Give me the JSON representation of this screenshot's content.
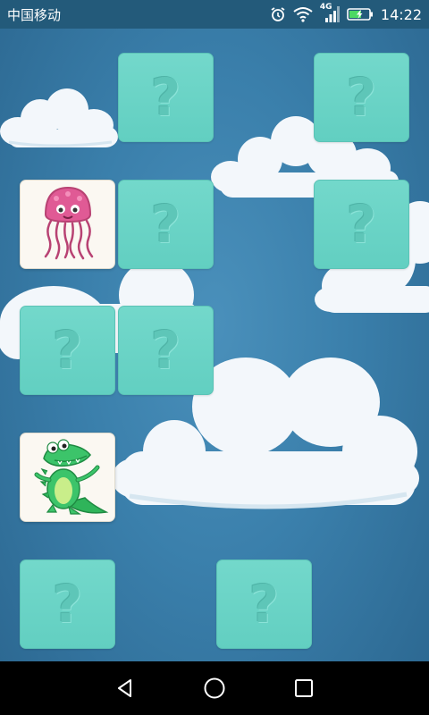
{
  "status_bar": {
    "carrier": "中国移动",
    "network": "4G",
    "time": "14:22",
    "icons": [
      "alarm-icon",
      "wifi-icon",
      "signal-icon",
      "battery-charging-icon"
    ]
  },
  "game": {
    "hidden_symbol": "?",
    "colors": {
      "background": "#3a7fab",
      "card_back": "#6ad3c6",
      "card_face": "#fbf8f2"
    },
    "cards": [
      {
        "row": 1,
        "col": 2,
        "state": "hidden"
      },
      {
        "row": 1,
        "col": 4,
        "state": "hidden"
      },
      {
        "row": 2,
        "col": 1,
        "state": "revealed",
        "picture": "jellyfish"
      },
      {
        "row": 2,
        "col": 2,
        "state": "hidden"
      },
      {
        "row": 2,
        "col": 4,
        "state": "hidden"
      },
      {
        "row": 3,
        "col": 1,
        "state": "hidden"
      },
      {
        "row": 3,
        "col": 2,
        "state": "hidden"
      },
      {
        "row": 4,
        "col": 1,
        "state": "revealed",
        "picture": "crocodile"
      },
      {
        "row": 5,
        "col": 1,
        "state": "hidden"
      },
      {
        "row": 5,
        "col": 3,
        "state": "hidden"
      }
    ]
  },
  "nav_bar": {
    "buttons": [
      "back-icon",
      "home-icon",
      "recents-icon"
    ]
  }
}
